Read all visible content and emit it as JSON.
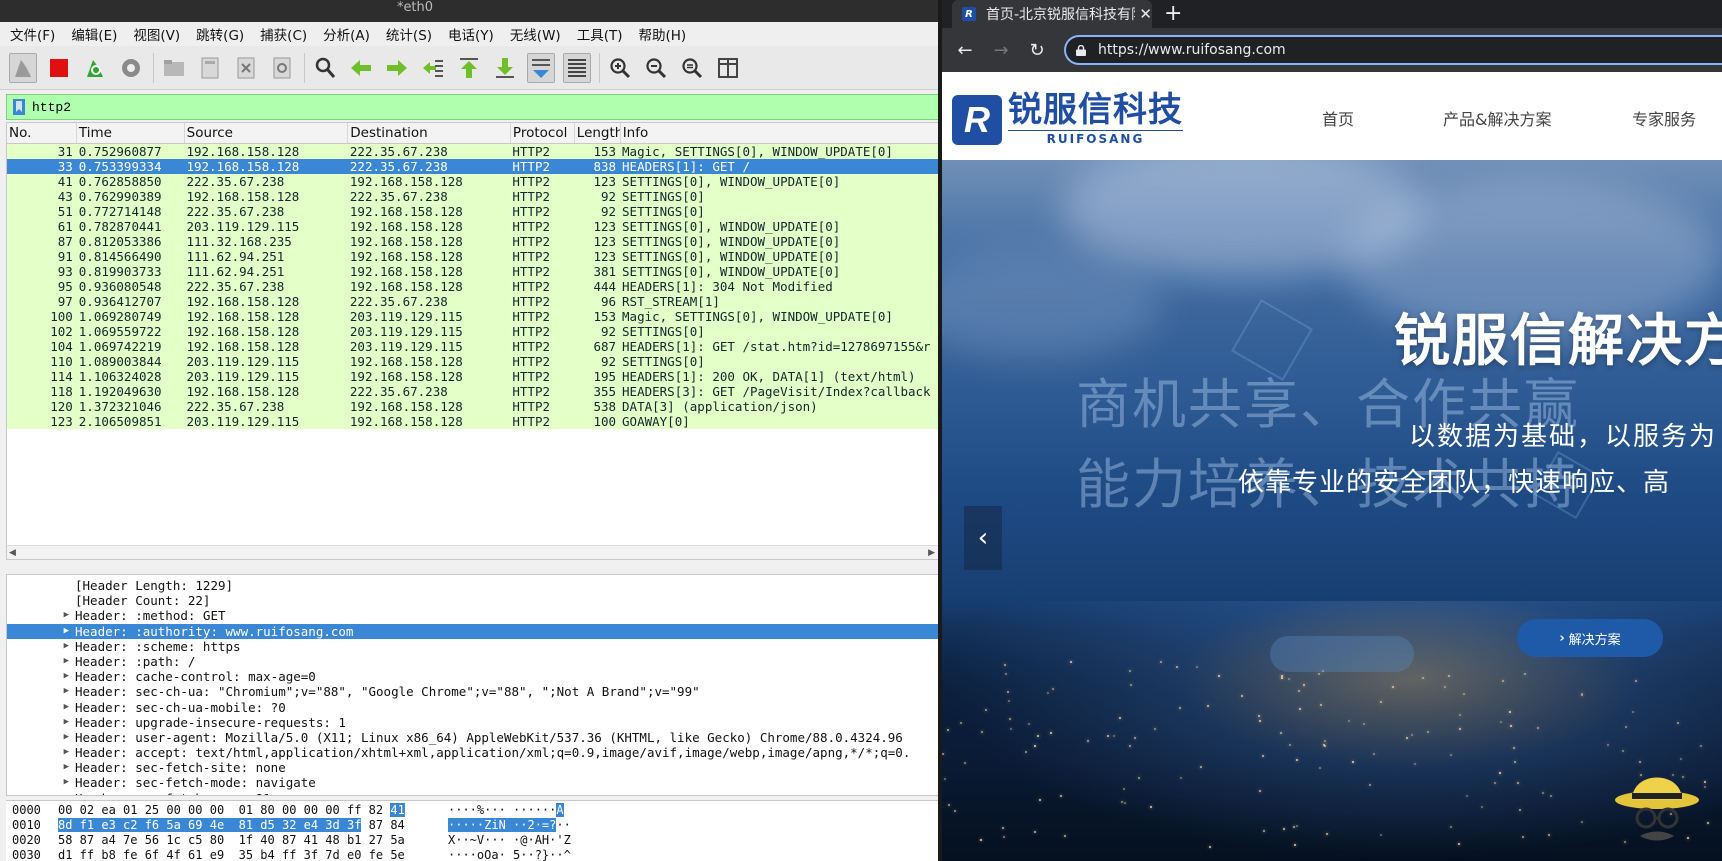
{
  "wireshark": {
    "title": "*eth0",
    "menu": [
      "文件(F)",
      "编辑(E)",
      "视图(V)",
      "跳转(G)",
      "捕获(C)",
      "分析(A)",
      "统计(S)",
      "电话(Y)",
      "无线(W)",
      "工具(T)",
      "帮助(H)"
    ],
    "toolbar_icons": [
      "shark-fin-start-icon",
      "stop-capture-icon",
      "restart-capture-icon",
      "capture-options-icon",
      "open-file-icon",
      "save-file-icon",
      "close-file-icon",
      "reload-file-icon",
      "find-packet-icon",
      "go-back-icon",
      "go-forward-icon",
      "go-to-packet-icon",
      "go-first-icon",
      "go-last-icon",
      "autoscroll-icon",
      "colorize-icon",
      "zoom-in-icon",
      "zoom-out-icon",
      "zoom-normal-icon",
      "resize-columns-icon"
    ],
    "filter": "http2",
    "columns": [
      "No.",
      "Time",
      "Source",
      "Destination",
      "Protocol",
      "Length",
      "Info"
    ],
    "packets": [
      {
        "no": "31",
        "time": "0.752960877",
        "src": "192.168.158.128",
        "dst": "222.35.67.238",
        "proto": "HTTP2",
        "len": "153",
        "info": "Magic, SETTINGS[0], WINDOW_UPDATE[0]"
      },
      {
        "no": "33",
        "time": "0.753399334",
        "src": "192.168.158.128",
        "dst": "222.35.67.238",
        "proto": "HTTP2",
        "len": "838",
        "info": "HEADERS[1]: GET /"
      },
      {
        "no": "41",
        "time": "0.762858850",
        "src": "222.35.67.238",
        "dst": "192.168.158.128",
        "proto": "HTTP2",
        "len": "123",
        "info": "SETTINGS[0], WINDOW_UPDATE[0]"
      },
      {
        "no": "43",
        "time": "0.762990389",
        "src": "192.168.158.128",
        "dst": "222.35.67.238",
        "proto": "HTTP2",
        "len": "92",
        "info": "SETTINGS[0]"
      },
      {
        "no": "51",
        "time": "0.772714148",
        "src": "222.35.67.238",
        "dst": "192.168.158.128",
        "proto": "HTTP2",
        "len": "92",
        "info": "SETTINGS[0]"
      },
      {
        "no": "61",
        "time": "0.782870441",
        "src": "203.119.129.115",
        "dst": "192.168.158.128",
        "proto": "HTTP2",
        "len": "123",
        "info": "SETTINGS[0], WINDOW_UPDATE[0]"
      },
      {
        "no": "87",
        "time": "0.812053386",
        "src": "111.32.168.235",
        "dst": "192.168.158.128",
        "proto": "HTTP2",
        "len": "123",
        "info": "SETTINGS[0], WINDOW_UPDATE[0]"
      },
      {
        "no": "91",
        "time": "0.814566490",
        "src": "111.62.94.251",
        "dst": "192.168.158.128",
        "proto": "HTTP2",
        "len": "123",
        "info": "SETTINGS[0], WINDOW_UPDATE[0]"
      },
      {
        "no": "93",
        "time": "0.819903733",
        "src": "111.62.94.251",
        "dst": "192.168.158.128",
        "proto": "HTTP2",
        "len": "381",
        "info": "SETTINGS[0], WINDOW_UPDATE[0]"
      },
      {
        "no": "95",
        "time": "0.936080548",
        "src": "222.35.67.238",
        "dst": "192.168.158.128",
        "proto": "HTTP2",
        "len": "444",
        "info": "HEADERS[1]: 304 Not Modified"
      },
      {
        "no": "97",
        "time": "0.936412707",
        "src": "192.168.158.128",
        "dst": "222.35.67.238",
        "proto": "HTTP2",
        "len": "96",
        "info": "RST_STREAM[1]"
      },
      {
        "no": "100",
        "time": "1.069280749",
        "src": "192.168.158.128",
        "dst": "203.119.129.115",
        "proto": "HTTP2",
        "len": "153",
        "info": "Magic, SETTINGS[0], WINDOW_UPDATE[0]"
      },
      {
        "no": "102",
        "time": "1.069559722",
        "src": "192.168.158.128",
        "dst": "203.119.129.115",
        "proto": "HTTP2",
        "len": "92",
        "info": "SETTINGS[0]"
      },
      {
        "no": "104",
        "time": "1.069742219",
        "src": "192.168.158.128",
        "dst": "203.119.129.115",
        "proto": "HTTP2",
        "len": "687",
        "info": "HEADERS[1]: GET /stat.htm?id=1278697155&r"
      },
      {
        "no": "110",
        "time": "1.089003844",
        "src": "203.119.129.115",
        "dst": "192.168.158.128",
        "proto": "HTTP2",
        "len": "92",
        "info": "SETTINGS[0]"
      },
      {
        "no": "114",
        "time": "1.106324028",
        "src": "203.119.129.115",
        "dst": "192.168.158.128",
        "proto": "HTTP2",
        "len": "195",
        "info": "HEADERS[1]: 200 OK, DATA[1] (text/html)"
      },
      {
        "no": "118",
        "time": "1.192049630",
        "src": "192.168.158.128",
        "dst": "222.35.67.238",
        "proto": "HTTP2",
        "len": "355",
        "info": "HEADERS[3]: GET /PageVisit/Index?callback"
      },
      {
        "no": "120",
        "time": "1.372321046",
        "src": "222.35.67.238",
        "dst": "192.168.158.128",
        "proto": "HTTP2",
        "len": "538",
        "info": "DATA[3] (application/json)"
      },
      {
        "no": "123",
        "time": "2.106509851",
        "src": "203.119.129.115",
        "dst": "192.168.158.128",
        "proto": "HTTP2",
        "len": "100",
        "info": "GOAWAY[0]"
      }
    ],
    "selected_packet_index": 1,
    "details": [
      {
        "text": "[Header Length: 1229]",
        "expandable": false
      },
      {
        "text": "[Header Count: 22]",
        "expandable": false
      },
      {
        "text": "Header: :method: GET",
        "expandable": true
      },
      {
        "text": "Header: :authority: www.ruifosang.com",
        "expandable": true
      },
      {
        "text": "Header: :scheme: https",
        "expandable": true
      },
      {
        "text": "Header: :path: /",
        "expandable": true
      },
      {
        "text": "Header: cache-control: max-age=0",
        "expandable": true
      },
      {
        "text": "Header: sec-ch-ua: \"Chromium\";v=\"88\", \"Google Chrome\";v=\"88\", \";Not A Brand\";v=\"99\"",
        "expandable": true
      },
      {
        "text": "Header: sec-ch-ua-mobile: ?0",
        "expandable": true
      },
      {
        "text": "Header: upgrade-insecure-requests: 1",
        "expandable": true
      },
      {
        "text": "Header: user-agent: Mozilla/5.0 (X11; Linux x86_64) AppleWebKit/537.36 (KHTML, like Gecko) Chrome/88.0.4324.96",
        "expandable": true
      },
      {
        "text": "Header: accept: text/html,application/xhtml+xml,application/xml;q=0.9,image/avif,image/webp,image/apng,*/*;q=0.",
        "expandable": true
      },
      {
        "text": "Header: sec-fetch-site: none",
        "expandable": true
      },
      {
        "text": "Header: sec-fetch-mode: navigate",
        "expandable": true
      },
      {
        "text": "Header: sec-fetch-user: ?1",
        "expandable": true
      }
    ],
    "selected_detail_index": 3,
    "bytes": [
      {
        "off": "0000",
        "hex_a": "00 02 ea 01 25 00 00 00  01 80 00 00 00 ff 82 ",
        "hex_b": "41",
        "hex_c": "",
        "asc_a": "····%··· ······",
        "asc_b": "A",
        "asc_c": ""
      },
      {
        "off": "0010",
        "hex_a": "",
        "hex_b": "8d f1 e3 c2 f6 5a 69 4e  81 d5 32 e4 3d 3f",
        "hex_c": " 87 84",
        "asc_a": "",
        "asc_b": "·····ZiN ··2·=?",
        "asc_c": "··"
      },
      {
        "off": "0020",
        "hex_a": "58 87 a4 7e 56 1c c5 80  1f 40 87 41 48 b1 27 5a",
        "hex_b": "",
        "hex_c": "",
        "asc_a": "X··~V··· ·@·AH·'Z",
        "asc_b": "",
        "asc_c": ""
      },
      {
        "off": "0030",
        "hex_a": "d1 ff b8 fe 6f 4f 61 e9  35 b4 ff 3f 7d e0 fe 5e",
        "hex_b": "",
        "hex_c": "",
        "asc_a": "····oOa· 5··?}··^",
        "asc_b": "",
        "asc_c": ""
      }
    ]
  },
  "browser": {
    "tab_title": "首页-北京锐服信科技有限",
    "url": "https://www.ruifosang.com",
    "site": {
      "logo_cn": "锐服信科技",
      "logo_en": "RUIFOSANG",
      "nav": [
        "首页",
        "产品&解决方案",
        "专家服务"
      ],
      "hero_title": "锐服信解决方",
      "hero_ghost1": "商机共享、合作共赢",
      "hero_ghost2": "能力培养、技术共持",
      "hero_sub1": "以数据为基础，以服务为",
      "hero_sub2": "依靠专业的安全团队，快速响应、高",
      "hero_button": "解决方案",
      "colors": {
        "brand": "#1f4ea3",
        "button": "#1f5aa8"
      }
    }
  }
}
